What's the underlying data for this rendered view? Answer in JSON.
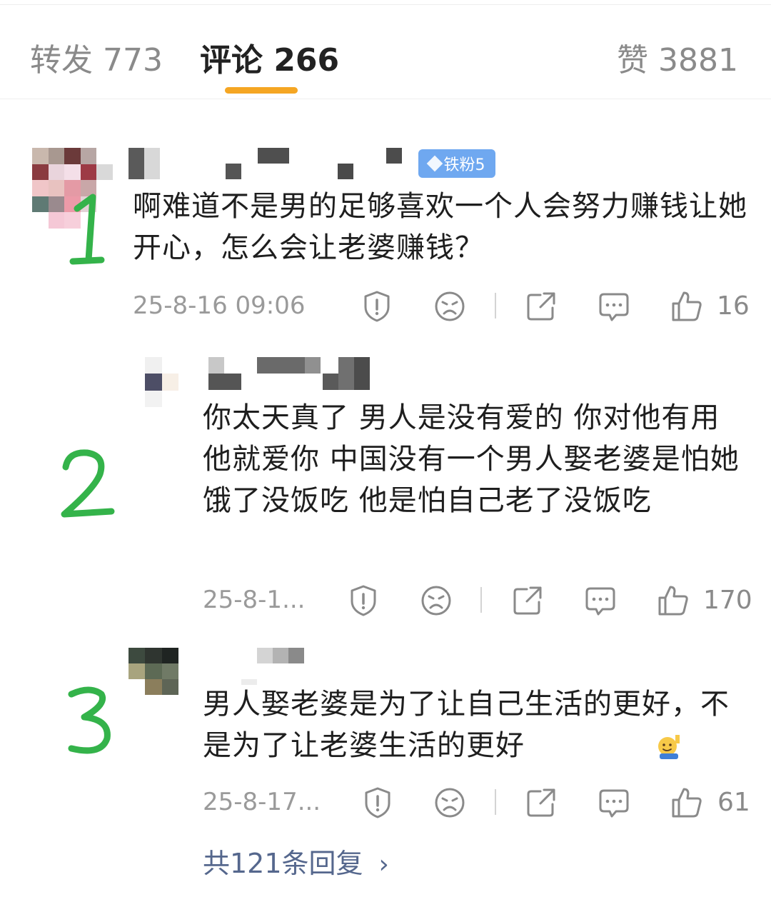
{
  "tabs": {
    "forward": "转发 773",
    "comments": "评论 266",
    "likes": "赞 3881",
    "accent_color": "#f5a623"
  },
  "badge": {
    "label": "铁粉5",
    "color": "#6fa8f0"
  },
  "annotation_color": "#34b34a",
  "comments": [
    {
      "annotation": "1",
      "text": "啊难道不是男的足够喜欢一个人会努力赚钱让她开心，怎么会让老婆赚钱？",
      "time": "25-8-16 09:06",
      "likes": "16"
    },
    {
      "annotation": "2",
      "text": "你太天真了 男人是没有爱的 你对他有用他就爱你  中国没有一个男人娶老婆是怕她饿了没饭吃 他是怕自己老了没饭吃",
      "time": "25-8-1...",
      "likes": "170"
    },
    {
      "annotation": "3",
      "text": "男人娶老婆是为了让自己生活的更好，不是为了让老婆生活的更好",
      "emoji": "raising-hand-emoji",
      "time": "25-8-17...",
      "likes": "61"
    }
  ],
  "replies_link": "共121条回复",
  "icons": [
    "report-icon",
    "dislike-face-icon",
    "share-icon",
    "comment-icon",
    "thumbs-up-icon",
    "chevron-right-icon"
  ]
}
